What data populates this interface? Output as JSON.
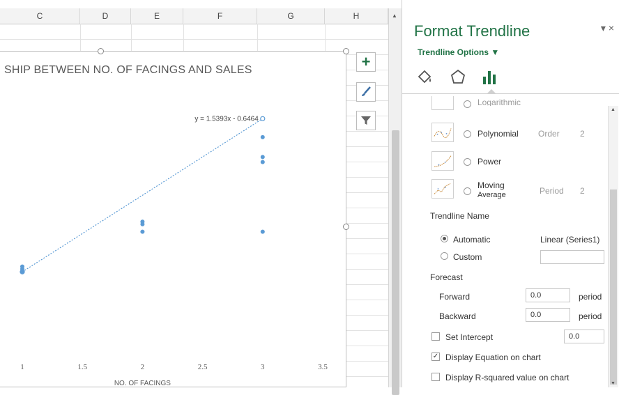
{
  "sheet": {
    "columns": [
      "C",
      "D",
      "E",
      "F",
      "G",
      "H"
    ]
  },
  "chart_data": {
    "type": "scatter",
    "title": "SHIP BETWEEN NO. OF FACINGS AND SALES",
    "xlabel": "NO. OF FACINGS",
    "ylabel": "",
    "xlim": [
      1,
      3.5
    ],
    "x_ticks": [
      "1",
      "1.5",
      "2",
      "2.5",
      "3",
      "3.5"
    ],
    "series": [
      {
        "x": [
          1,
          1,
          1,
          2,
          2,
          2,
          3,
          3,
          3,
          3
        ],
        "y": [
          1.0,
          0.95,
          0.9,
          1.9,
          1.85,
          1.7,
          3.6,
          3.2,
          3.1,
          1.7
        ]
      }
    ],
    "trendline": {
      "slope": 1.5393,
      "intercept": -0.6464,
      "x_range": [
        1,
        3
      ],
      "equation": "y = 1.5393x - 0.6464"
    },
    "ylim": [
      0,
      4.2
    ]
  },
  "pane": {
    "title": "Format Trendline",
    "close": "▾ ×",
    "subtitle": "Trendline Options ▼",
    "options": {
      "logarithmic": "Logarithmic",
      "polynomial": "Polynomial",
      "order_label": "Order",
      "order_value": "2",
      "power": "Power",
      "moving": "Moving",
      "average": "Average",
      "period_label": "Period",
      "period_value": "2"
    },
    "trendline_name": {
      "heading": "Trendline Name",
      "automatic": "Automatic",
      "automatic_value": "Linear (Series1)",
      "custom": "Custom"
    },
    "forecast": {
      "heading": "Forecast",
      "forward": "Forward",
      "forward_value": "0.0",
      "backward": "Backward",
      "backward_value": "0.0",
      "unit": "period"
    },
    "set_intercept": "Set Intercept",
    "intercept_value": "0.0",
    "display_equation": "Display Equation on chart",
    "display_rsquared": "Display R-squared value on chart",
    "check_mark": "✓"
  },
  "icons": {
    "plus": "+",
    "accent": "#217346"
  }
}
